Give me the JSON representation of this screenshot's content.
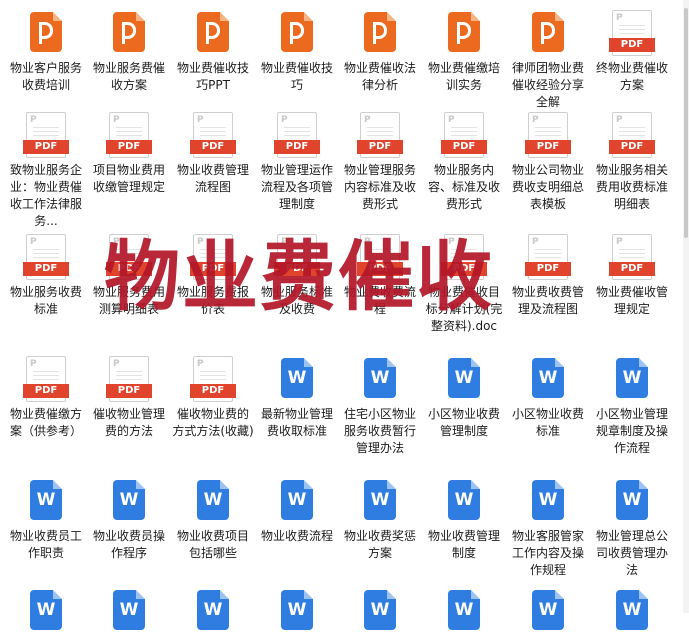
{
  "watermark": "物业费催收",
  "icon_labels": {
    "pdf": "PDF",
    "word": "W"
  },
  "files": [
    {
      "type": "ppt",
      "name": "物业客户服务收费培训"
    },
    {
      "type": "ppt",
      "name": "物业服务费催收方案"
    },
    {
      "type": "ppt",
      "name": "物业费催收技巧PPT"
    },
    {
      "type": "ppt",
      "name": "物业费催收技巧"
    },
    {
      "type": "ppt",
      "name": "物业费催收法律分析"
    },
    {
      "type": "ppt",
      "name": "物业费催缴培训实务"
    },
    {
      "type": "ppt",
      "name": "律师团物业费催收经验分享全解"
    },
    {
      "type": "pdf",
      "name": "终物业费催收方案"
    },
    {
      "type": "pdf",
      "name": "致物业服务企业：物业费催收工作法律服务..."
    },
    {
      "type": "pdf",
      "name": "项目物业费用收缴管理规定"
    },
    {
      "type": "pdf",
      "name": "物业收费管理流程图"
    },
    {
      "type": "pdf",
      "name": "物业管理运作流程及各项管理制度"
    },
    {
      "type": "pdf",
      "name": "物业管理服务内容标准及收费形式"
    },
    {
      "type": "pdf",
      "name": "物业服务内容、标准及收费形式"
    },
    {
      "type": "pdf",
      "name": "物业公司物业费收支明细总表模板"
    },
    {
      "type": "pdf",
      "name": "物业服务相关费用收费标准明细表"
    },
    {
      "type": "pdf",
      "name": "物业服务收费标准"
    },
    {
      "type": "pdf",
      "name": "物业服务费用测算明细表"
    },
    {
      "type": "pdf",
      "name": "物业服务费报价表"
    },
    {
      "type": "pdf",
      "name": "物业服务标准及收费"
    },
    {
      "type": "pdf",
      "name": "物业费收费流程"
    },
    {
      "type": "pdf",
      "name": "物业费催收目标分解计划(完整资料).doc"
    },
    {
      "type": "pdf",
      "name": "物业费收费管理及流程图"
    },
    {
      "type": "pdf",
      "name": "物业费催收管理规定"
    },
    {
      "type": "pdf",
      "name": "物业费催缴方案（供参考）"
    },
    {
      "type": "pdf",
      "name": "催收物业管理费的方法"
    },
    {
      "type": "pdf",
      "name": "催收物业费的方式方法(收藏)"
    },
    {
      "type": "word",
      "name": "最新物业管理费收取标准"
    },
    {
      "type": "word",
      "name": "住宅小区物业服务收费暂行管理办法"
    },
    {
      "type": "word",
      "name": "小区物业收费管理制度"
    },
    {
      "type": "word",
      "name": "小区物业收费标准"
    },
    {
      "type": "word",
      "name": "小区物业管理规章制度及操作流程"
    },
    {
      "type": "word",
      "name": "物业收费员工作职责"
    },
    {
      "type": "word",
      "name": "物业收费员操作程序"
    },
    {
      "type": "word",
      "name": "物业收费项目包括哪些"
    },
    {
      "type": "word",
      "name": "物业收费流程"
    },
    {
      "type": "word",
      "name": "物业收费奖惩方案"
    },
    {
      "type": "word",
      "name": "物业收费管理制度"
    },
    {
      "type": "word",
      "name": "物业客服管家工作内容及操作规程"
    },
    {
      "type": "word",
      "name": "物业管理总公司收费管理办法"
    },
    {
      "type": "word",
      "name": ""
    },
    {
      "type": "word",
      "name": ""
    },
    {
      "type": "word",
      "name": ""
    },
    {
      "type": "word",
      "name": ""
    },
    {
      "type": "word",
      "name": ""
    },
    {
      "type": "word",
      "name": ""
    },
    {
      "type": "word",
      "name": ""
    },
    {
      "type": "word",
      "name": ""
    }
  ]
}
